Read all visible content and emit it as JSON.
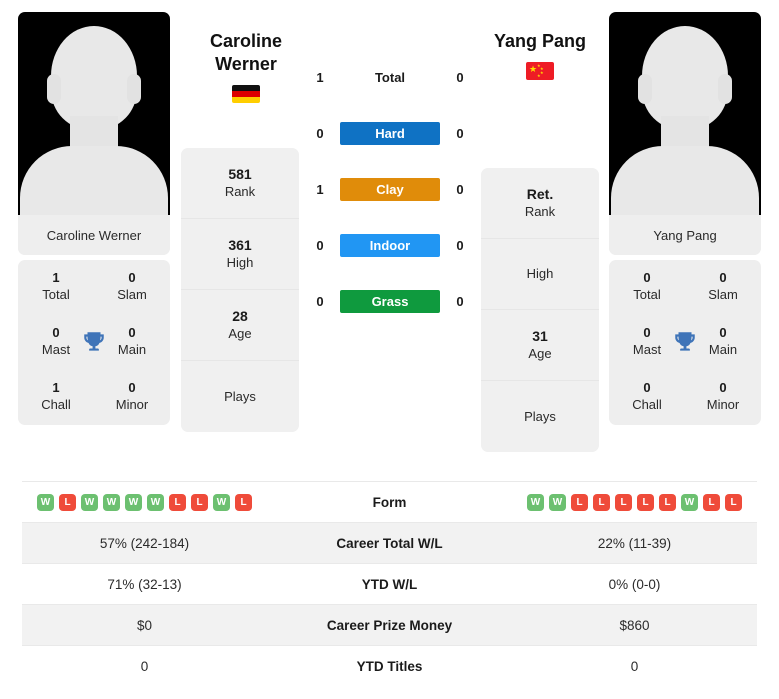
{
  "players": {
    "left": {
      "name": "Caroline Werner",
      "display_name_line1": "Caroline",
      "display_name_line2": "Werner",
      "country": "germany-flag",
      "avatar": "player-avatar-placeholder",
      "titles": {
        "total_value": "1",
        "total_label": "Total",
        "slam_value": "0",
        "slam_label": "Slam",
        "mast_value": "0",
        "mast_label": "Mast",
        "main_value": "0",
        "main_label": "Main",
        "chall_value": "1",
        "chall_label": "Chall",
        "minor_value": "0",
        "minor_label": "Minor"
      },
      "rank_rows": [
        {
          "value": "581",
          "label": "Rank"
        },
        {
          "value": "361",
          "label": "High"
        },
        {
          "value": "28",
          "label": "Age"
        },
        {
          "value": "",
          "label": "Plays"
        }
      ],
      "form": [
        "W",
        "L",
        "W",
        "W",
        "W",
        "W",
        "L",
        "L",
        "W",
        "L"
      ],
      "career_total_wl": "57% (242-184)",
      "ytd_wl": "71% (32-13)",
      "career_prize_money": "$0",
      "ytd_titles": "0"
    },
    "right": {
      "name": "Yang Pang",
      "display_name_line1": "Yang Pang",
      "display_name_line2": "",
      "country": "china-flag",
      "avatar": "player-avatar-placeholder",
      "titles": {
        "total_value": "0",
        "total_label": "Total",
        "slam_value": "0",
        "slam_label": "Slam",
        "mast_value": "0",
        "mast_label": "Mast",
        "main_value": "0",
        "main_label": "Main",
        "chall_value": "0",
        "chall_label": "Chall",
        "minor_value": "0",
        "minor_label": "Minor"
      },
      "rank_rows": [
        {
          "value": "Ret.",
          "label": "Rank"
        },
        {
          "value": "",
          "label": "High"
        },
        {
          "value": "31",
          "label": "Age"
        },
        {
          "value": "",
          "label": "Plays"
        }
      ],
      "form": [
        "W",
        "W",
        "L",
        "L",
        "L",
        "L",
        "L",
        "W",
        "L",
        "L"
      ],
      "career_total_wl": "22% (11-39)",
      "ytd_wl": "0% (0-0)",
      "career_prize_money": "$860",
      "ytd_titles": "0"
    }
  },
  "surfaces": [
    {
      "label": "Total",
      "left": "1",
      "right": "0",
      "color": "transparent",
      "plain": true
    },
    {
      "label": "Hard",
      "left": "0",
      "right": "0",
      "color": "#0f72c4",
      "plain": false
    },
    {
      "label": "Clay",
      "left": "1",
      "right": "0",
      "color": "#e08c0a",
      "plain": false
    },
    {
      "label": "Indoor",
      "left": "0",
      "right": "0",
      "color": "#2196f3",
      "plain": false
    },
    {
      "label": "Grass",
      "left": "0",
      "right": "0",
      "color": "#0f9a3e",
      "plain": false
    }
  ],
  "table": {
    "rows": [
      {
        "label": "Form"
      },
      {
        "label": "Career Total W/L"
      },
      {
        "label": "YTD W/L"
      },
      {
        "label": "Career Prize Money"
      },
      {
        "label": "YTD Titles"
      }
    ]
  },
  "colors": {
    "win": "#6cc070",
    "loss": "#ef4b3a",
    "hard": "#0f72c4",
    "clay": "#e08c0a",
    "indoor": "#2196f3",
    "grass": "#0f9a3e",
    "trophy": "#3f74b8",
    "card_bg": "#eeeeee",
    "row_alt_bg": "#f2f2f2"
  }
}
